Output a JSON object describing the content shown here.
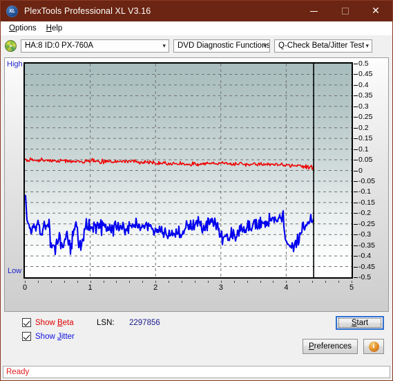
{
  "window": {
    "title": "PlexTools Professional XL V3.16",
    "app_icon": "XL",
    "icon_name": "plextools-xl-icon",
    "accent_titlebar": "#6b2512",
    "controls": {
      "minimize": "–",
      "maximize": "□",
      "close": "✕"
    }
  },
  "menubar": {
    "items": [
      {
        "label": "Options",
        "accel": "O"
      },
      {
        "label": "Help",
        "accel": "H"
      }
    ]
  },
  "toolbar": {
    "disc_icon": "optical-disc-icon",
    "drive_select": {
      "value": "HA:8 ID:0  PX-760A",
      "chevron": "⌄"
    },
    "function_select": {
      "value": "DVD Diagnostic Functions",
      "chevron": "⌄"
    },
    "test_select": {
      "value": "Q-Check Beta/Jitter Test",
      "chevron": "⌄"
    }
  },
  "chart_data": {
    "type": "line",
    "title": "Q-Check Beta/Jitter Test",
    "xlabel": "",
    "ylabel": "",
    "grid": true,
    "legend_position": "bottom-left",
    "xlim": [
      0,
      5
    ],
    "ylim": [
      -0.5,
      0.5
    ],
    "xticks": [
      0,
      1,
      2,
      3,
      4,
      5
    ],
    "xtick_labels": [
      "0",
      "1",
      "2",
      "3",
      "4",
      "5"
    ],
    "yticks": [
      0.5,
      0.45,
      0.4,
      0.35,
      0.3,
      0.25,
      0.2,
      0.15,
      0.1,
      0.05,
      0,
      -0.05,
      -0.1,
      -0.15,
      -0.2,
      -0.25,
      -0.3,
      -0.35,
      -0.4,
      -0.45,
      -0.5
    ],
    "ytick_labels": [
      "0.5",
      "0.45",
      "0.4",
      "0.35",
      "0.3",
      "0.25",
      "0.2",
      "0.15",
      "0.1",
      "0.05",
      "0",
      "-0.05",
      "-0.1",
      "-0.15",
      "-0.2",
      "-0.25",
      "-0.3",
      "-0.35",
      "-0.4",
      "-0.45",
      "-0.5"
    ],
    "axis_high_label": "High",
    "axis_low_label": "Low",
    "data_end_marker_x": 4.42,
    "series": [
      {
        "name": "Beta",
        "color": "#ee0000",
        "x": [
          0.0,
          0.05,
          0.1,
          0.15,
          0.2,
          0.25,
          0.3,
          0.35,
          0.4,
          0.45,
          0.5,
          0.55,
          0.6,
          0.65,
          0.7,
          0.75,
          0.8,
          0.85,
          0.9,
          0.95,
          1.0,
          1.05,
          1.1,
          1.15,
          1.2,
          1.25,
          1.3,
          1.35,
          1.4,
          1.45,
          1.5,
          1.55,
          1.6,
          1.65,
          1.7,
          1.75,
          1.8,
          1.85,
          1.9,
          1.95,
          2.0,
          2.05,
          2.1,
          2.15,
          2.2,
          2.25,
          2.3,
          2.35,
          2.4,
          2.45,
          2.5,
          2.55,
          2.6,
          2.65,
          2.7,
          2.75,
          2.8,
          2.85,
          2.9,
          2.95,
          3.0,
          3.05,
          3.1,
          3.15,
          3.2,
          3.25,
          3.3,
          3.35,
          3.4,
          3.45,
          3.5,
          3.55,
          3.6,
          3.65,
          3.7,
          3.75,
          3.8,
          3.85,
          3.9,
          3.95,
          4.0,
          4.05,
          4.1,
          4.15,
          4.2,
          4.25,
          4.3,
          4.35,
          4.4,
          4.42
        ],
        "y": [
          0.05,
          0.048,
          0.052,
          0.049,
          0.046,
          0.05,
          0.047,
          0.044,
          0.048,
          0.045,
          0.043,
          0.046,
          0.042,
          0.045,
          0.041,
          0.044,
          0.04,
          0.043,
          0.041,
          0.045,
          0.048,
          0.046,
          0.043,
          0.04,
          0.042,
          0.039,
          0.041,
          0.038,
          0.04,
          0.043,
          0.046,
          0.044,
          0.041,
          0.044,
          0.042,
          0.039,
          0.041,
          0.038,
          0.036,
          0.038,
          0.035,
          0.033,
          0.036,
          0.034,
          0.031,
          0.033,
          0.03,
          0.032,
          0.029,
          0.031,
          0.028,
          0.03,
          0.032,
          0.029,
          0.031,
          0.034,
          0.036,
          0.033,
          0.035,
          0.032,
          0.034,
          0.031,
          0.033,
          0.03,
          0.032,
          0.029,
          0.031,
          0.028,
          0.03,
          0.027,
          0.029,
          0.031,
          0.028,
          0.03,
          0.027,
          0.029,
          0.026,
          0.028,
          0.025,
          0.027,
          0.024,
          0.022,
          0.024,
          0.021,
          0.019,
          0.021,
          0.018,
          0.016,
          0.014,
          0.013
        ]
      },
      {
        "name": "Jitter",
        "color": "#0000ee",
        "x": [
          0.0,
          0.02,
          0.05,
          0.08,
          0.1,
          0.13,
          0.16,
          0.19,
          0.22,
          0.25,
          0.28,
          0.31,
          0.34,
          0.37,
          0.4,
          0.43,
          0.46,
          0.49,
          0.52,
          0.55,
          0.58,
          0.61,
          0.64,
          0.67,
          0.7,
          0.73,
          0.76,
          0.79,
          0.82,
          0.85,
          0.88,
          0.91,
          0.94,
          0.97,
          1.0,
          1.05,
          1.1,
          1.15,
          1.2,
          1.25,
          1.3,
          1.35,
          1.4,
          1.45,
          1.5,
          1.55,
          1.6,
          1.65,
          1.7,
          1.75,
          1.8,
          1.85,
          1.9,
          1.95,
          2.0,
          2.05,
          2.1,
          2.15,
          2.2,
          2.25,
          2.3,
          2.35,
          2.4,
          2.45,
          2.5,
          2.55,
          2.6,
          2.65,
          2.7,
          2.75,
          2.8,
          2.85,
          2.9,
          2.95,
          3.0,
          3.05,
          3.1,
          3.15,
          3.2,
          3.25,
          3.3,
          3.35,
          3.4,
          3.45,
          3.5,
          3.55,
          3.6,
          3.65,
          3.7,
          3.75,
          3.8,
          3.85,
          3.9,
          3.95,
          4.0,
          4.05,
          4.1,
          4.15,
          4.2,
          4.25,
          4.3,
          4.35,
          4.4,
          4.42
        ],
        "y": [
          -0.13,
          -0.18,
          -0.255,
          -0.262,
          -0.3,
          -0.265,
          -0.255,
          -0.27,
          -0.258,
          -0.3,
          -0.268,
          -0.258,
          -0.265,
          -0.258,
          -0.34,
          -0.355,
          -0.36,
          -0.345,
          -0.3,
          -0.355,
          -0.365,
          -0.35,
          -0.3,
          -0.355,
          -0.368,
          -0.3,
          -0.268,
          -0.262,
          -0.35,
          -0.362,
          -0.34,
          -0.3,
          -0.25,
          -0.27,
          -0.258,
          -0.27,
          -0.262,
          -0.268,
          -0.265,
          -0.272,
          -0.268,
          -0.275,
          -0.268,
          -0.272,
          -0.265,
          -0.27,
          -0.262,
          -0.268,
          -0.258,
          -0.262,
          -0.255,
          -0.258,
          -0.262,
          -0.268,
          -0.275,
          -0.282,
          -0.288,
          -0.295,
          -0.3,
          -0.305,
          -0.3,
          -0.292,
          -0.285,
          -0.275,
          -0.265,
          -0.258,
          -0.25,
          -0.245,
          -0.248,
          -0.252,
          -0.245,
          -0.248,
          -0.242,
          -0.246,
          -0.305,
          -0.315,
          -0.31,
          -0.3,
          -0.295,
          -0.288,
          -0.282,
          -0.276,
          -0.27,
          -0.265,
          -0.258,
          -0.252,
          -0.248,
          -0.242,
          -0.238,
          -0.232,
          -0.228,
          -0.222,
          -0.218,
          -0.212,
          -0.345,
          -0.348,
          -0.352,
          -0.345,
          -0.3,
          -0.28,
          -0.262,
          -0.248,
          -0.235,
          -0.23
        ]
      }
    ]
  },
  "controls": {
    "show_beta": {
      "label": "Show Beta",
      "accel": "B",
      "checked": true,
      "color": "#e00000"
    },
    "show_jitter": {
      "label": "Show Jitter",
      "accel": "J",
      "checked": true,
      "color": "#1010e0"
    },
    "lsn_label": "LSN:",
    "lsn_value": "2297856",
    "start_button": {
      "label": "Start",
      "accel": "S"
    },
    "preferences_button": {
      "label": "Preferences",
      "accel": "P"
    },
    "info_button": {
      "glyph": "i",
      "name": "info-icon"
    }
  },
  "statusbar": {
    "text": "Ready",
    "color": "#e02020"
  }
}
